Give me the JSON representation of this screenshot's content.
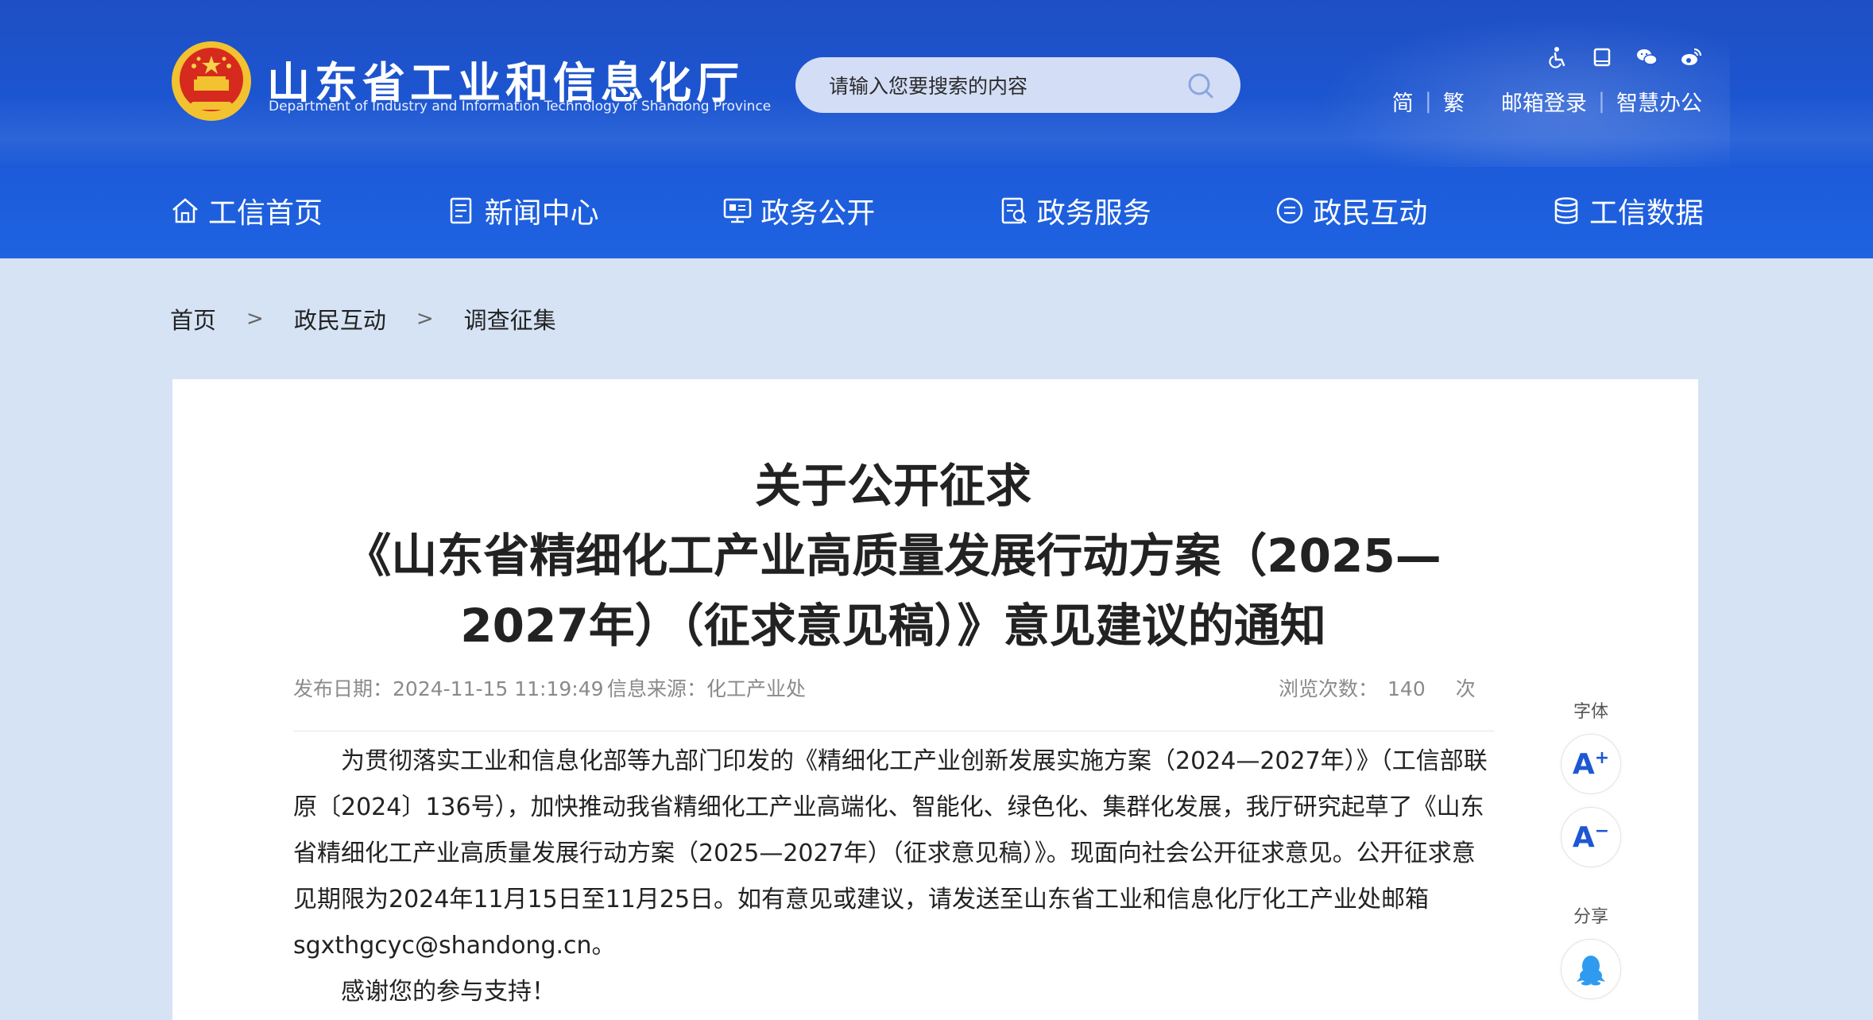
{
  "header": {
    "site_title": "山东省工业和信息化厅",
    "site_subtitle": "Department of Industry and Information Technology of Shandong Province",
    "search_placeholder": "请输入您要搜索的内容",
    "top_links": {
      "simplified": "简",
      "traditional": "繁",
      "mail_login": "邮箱登录",
      "smart_office": "智慧办公",
      "separator": "|"
    },
    "top_icons": [
      "accessibility-icon",
      "tablet-icon",
      "wechat-icon",
      "weibo-icon"
    ]
  },
  "nav": {
    "items": [
      {
        "label": "工信首页",
        "icon": "home-icon"
      },
      {
        "label": "新闻中心",
        "icon": "news-icon"
      },
      {
        "label": "政务公开",
        "icon": "monitor-icon"
      },
      {
        "label": "政务服务",
        "icon": "service-icon"
      },
      {
        "label": "政民互动",
        "icon": "chat-icon"
      },
      {
        "label": "工信数据",
        "icon": "database-icon"
      }
    ]
  },
  "breadcrumb": {
    "items": [
      "首页",
      "政民互动",
      "调查征集"
    ],
    "separator": ">"
  },
  "article": {
    "title_lines": [
      "关于公开征求",
      "《山东省精细化工产业高质量发展行动方案（2025—",
      "2027年）（征求意见稿）》意见建议的通知"
    ],
    "meta": {
      "date_label": "发布日期：",
      "date_value": "2024-11-15 11:19:49",
      "source_label": "信息来源：",
      "source_value": "化工产业处",
      "views_label": "浏览次数：",
      "views_value": "140",
      "views_unit": "次"
    },
    "paragraphs": [
      "为贯彻落实工业和信息化部等九部门印发的《精细化工产业创新发展实施方案（2024—2027年）》（工信部联原〔2024〕136号），加快推动我省精细化工产业高端化、智能化、绿色化、集群化发展，我厅研究起草了《山东省精细化工产业高质量发展行动方案（2025—2027年）（征求意见稿）》。现面向社会公开征求意见。公开征求意见期限为2024年11月15日至11月25日。如有意见或建议，请发送至山东省工业和信息化厅化工产业处邮箱sgxthgcyc@shandong.cn。",
      "感谢您的参与支持！"
    ]
  },
  "side_tools": {
    "font_label": "字体",
    "font_increase": "A",
    "font_increase_sign": "+",
    "font_decrease": "A",
    "font_decrease_sign": "−",
    "share_label": "分享"
  },
  "colors": {
    "header_blue": "#1b58d6",
    "page_bg": "#d6e3f5",
    "accent": "#1d57d4"
  }
}
